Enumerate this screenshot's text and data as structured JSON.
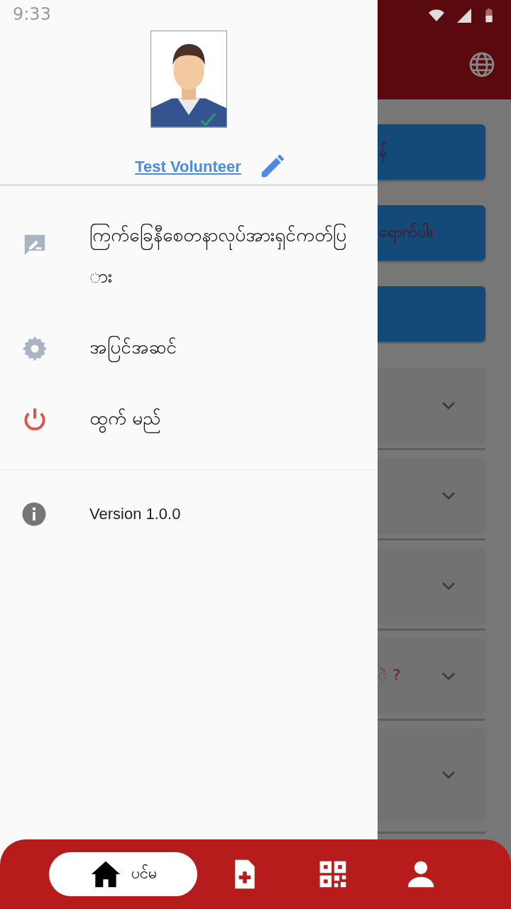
{
  "status_bar": {
    "time": "9:33"
  },
  "background_cards": [
    {
      "kind": "button",
      "text": "န်"
    },
    {
      "kind": "button",
      "text": "ရောက်ပါ။"
    },
    {
      "kind": "button"
    },
    {
      "kind": "expandable",
      "expanded": false
    },
    {
      "kind": "expandable",
      "expanded": false
    },
    {
      "kind": "expandable",
      "expanded": false
    },
    {
      "kind": "expandable",
      "expanded": false,
      "text": "ဲ ?"
    },
    {
      "kind": "expandable",
      "expanded": false
    }
  ],
  "drawer": {
    "profile": {
      "name": "Test Volunteer"
    },
    "menu": [
      {
        "label": "ကြက်ခြေနီစေတနာလုပ်အားရှင်ကတ်ပြား"
      },
      {
        "label": "အပြင်အဆင်"
      },
      {
        "label": "ထွက် မည်"
      }
    ],
    "version": "Version 1.0.0"
  },
  "bottom_nav": [
    {
      "label": "ပင်မ",
      "selected": true
    },
    {
      "selected": false
    },
    {
      "selected": false
    },
    {
      "selected": false
    }
  ]
}
